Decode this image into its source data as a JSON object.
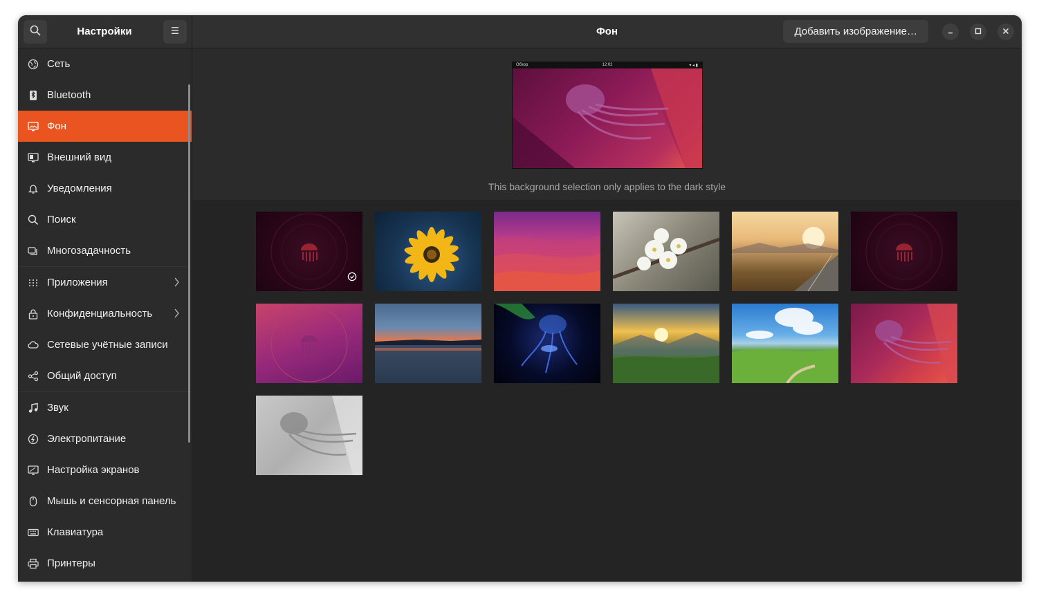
{
  "header": {
    "app_title": "Настройки",
    "page_title": "Фон",
    "add_image_label": "Добавить изображение…",
    "icons": {
      "search": "search-icon",
      "menu": "hamburger-menu-icon",
      "minimize": "minimize-icon",
      "maximize": "maximize-icon",
      "close": "close-icon"
    }
  },
  "sidebar": {
    "items": [
      {
        "label": "Сеть",
        "icon": "network-icon"
      },
      {
        "label": "Bluetooth",
        "icon": "bluetooth-icon"
      },
      {
        "label": "Фон",
        "icon": "background-icon",
        "active": true
      },
      {
        "label": "Внешний вид",
        "icon": "appearance-icon"
      },
      {
        "label": "Уведомления",
        "icon": "bell-icon"
      },
      {
        "label": "Поиск",
        "icon": "search-icon"
      },
      {
        "label": "Многозадачность",
        "icon": "multitasking-icon"
      },
      {
        "label": "Приложения",
        "icon": "apps-grid-icon",
        "has_submenu": true
      },
      {
        "label": "Конфиденциальность",
        "icon": "lock-icon",
        "has_submenu": true
      },
      {
        "label": "Сетевые учётные записи",
        "icon": "cloud-icon"
      },
      {
        "label": "Общий доступ",
        "icon": "share-icon"
      },
      {
        "label": "Звук",
        "icon": "music-note-icon"
      },
      {
        "label": "Электропитание",
        "icon": "power-icon"
      },
      {
        "label": "Настройка экранов",
        "icon": "display-icon"
      },
      {
        "label": "Мышь и сенсорная панель",
        "icon": "mouse-icon"
      },
      {
        "label": "Клавиатура",
        "icon": "keyboard-icon"
      },
      {
        "label": "Принтеры",
        "icon": "printer-icon"
      }
    ]
  },
  "preview": {
    "topbar_left": "Обзор",
    "topbar_clock": "12:02",
    "caption": "This background selection only applies to the dark style"
  },
  "wallpapers": [
    {
      "name": "jellyfish-dark-clock",
      "timed": true
    },
    {
      "name": "yellow-flower"
    },
    {
      "name": "pink-waves"
    },
    {
      "name": "white-blossoms"
    },
    {
      "name": "sunset-road"
    },
    {
      "name": "jellyfish-dark"
    },
    {
      "name": "jellyfish-purple"
    },
    {
      "name": "lake-sunset"
    },
    {
      "name": "blue-jellyfish"
    },
    {
      "name": "mountain-sunrise"
    },
    {
      "name": "green-hills"
    },
    {
      "name": "jellyfish-pink"
    },
    {
      "name": "jellyfish-grey"
    }
  ],
  "colors": {
    "accent": "#e95420",
    "window_bg": "#242424",
    "sidebar_bg": "#2b2b2b",
    "header_bg": "#303030"
  }
}
